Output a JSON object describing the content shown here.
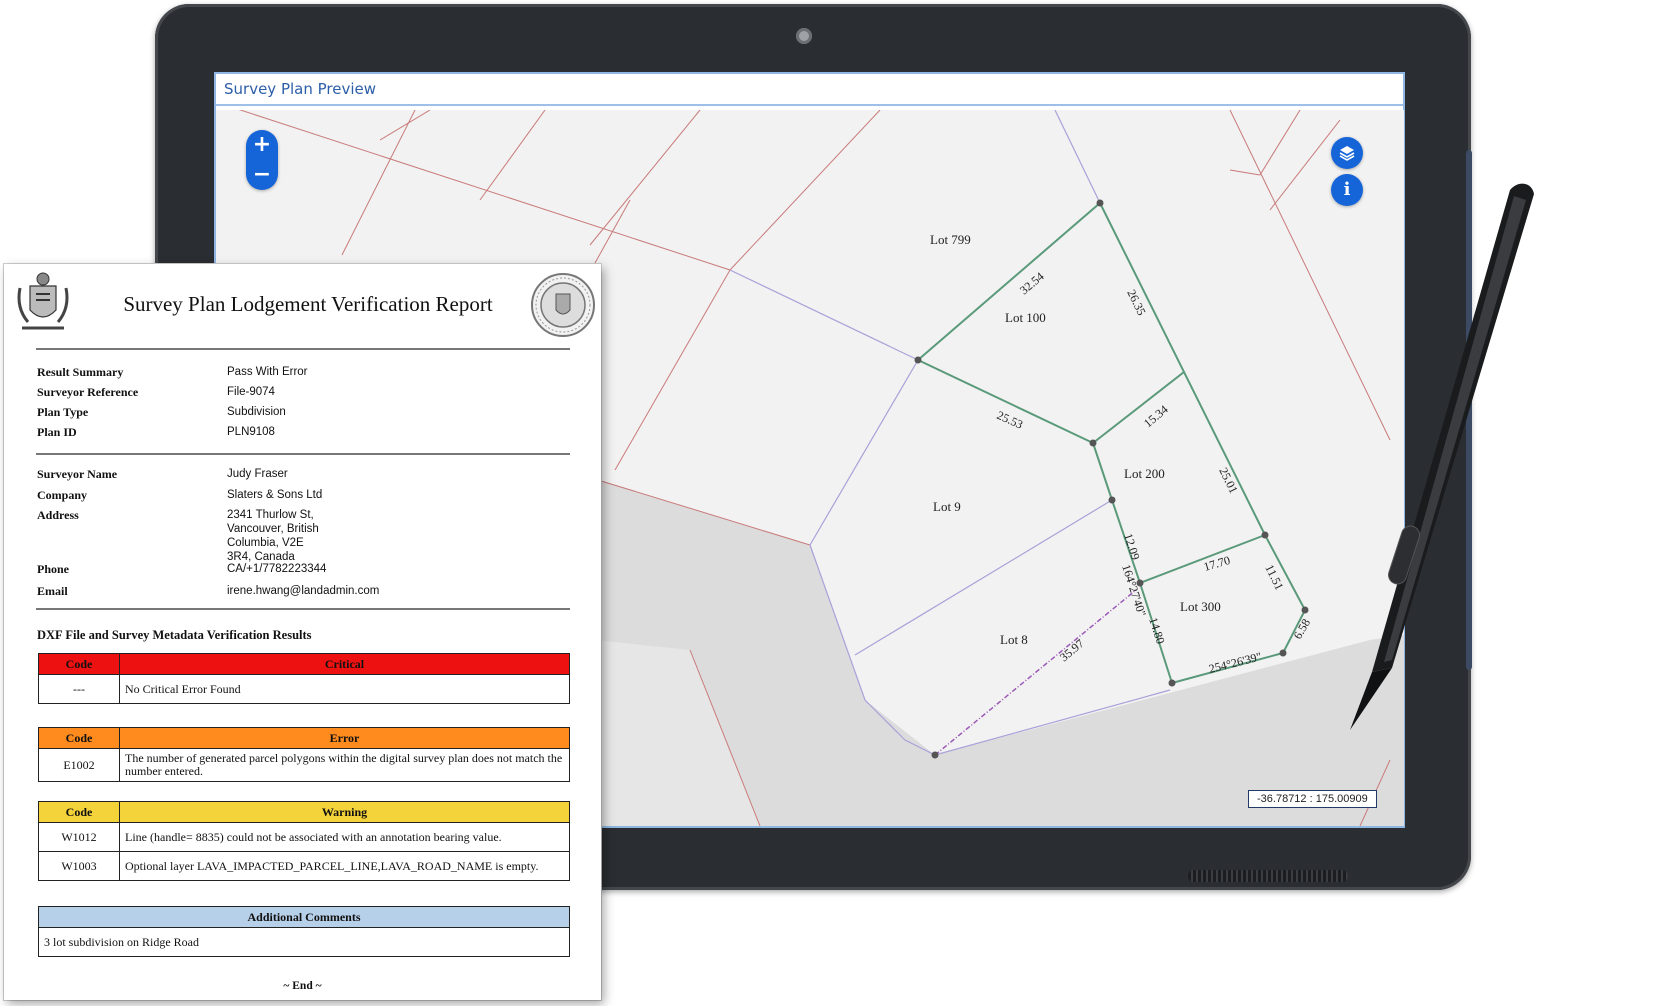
{
  "screen": {
    "title": "Survey Plan Preview"
  },
  "map": {
    "zoom_in_label": "+",
    "zoom_out_label": "−",
    "layers_icon": "layers-icon",
    "info_icon": "info-icon",
    "coordinate_readout": "-36.78712 : 175.00909",
    "lot_labels": [
      "Lot 799",
      "Lot 100",
      "Lot 200",
      "Lot 9",
      "Lot 8",
      "Lot 300"
    ],
    "dimensions": [
      "32.54",
      "26.35",
      "25.53",
      "15.34",
      "25.01",
      "17.70",
      "12.09",
      "11.51",
      "14.80",
      "6.58",
      "35.97",
      "164°27'40\"",
      "254°26'39\""
    ],
    "colors": {
      "parcel_line": "#c56b6b",
      "boundary": "#5a9a7a",
      "road": "#a8a2d9",
      "accent": "#1665d8"
    }
  },
  "report": {
    "title": "Survey Plan Lodgement Verification Report",
    "summary": [
      {
        "label": "Result Summary",
        "value": "Pass With Error"
      },
      {
        "label": "Surveyor Reference",
        "value": "File-9074"
      },
      {
        "label": "Plan Type",
        "value": "Subdivision"
      },
      {
        "label": "Plan ID",
        "value": "PLN9108"
      }
    ],
    "surveyor": [
      {
        "label": "Surveyor Name",
        "value": "Judy Fraser"
      },
      {
        "label": "Company",
        "value": "Slaters & Sons Ltd"
      },
      {
        "label": "Address",
        "value": "2341 Thurlow St,\nVancouver, British\nColumbia, V2E\n3R4, Canada"
      },
      {
        "label": "Phone",
        "value": "CA/+1/7782223344"
      },
      {
        "label": "Email",
        "value": "irene.hwang@landadmin.com"
      }
    ],
    "results_heading": "DXF File and Survey Metadata Verification Results",
    "critical": {
      "code_header": "Code",
      "header": "Critical",
      "color": "#ee1111",
      "rows": [
        {
          "code": "---",
          "text": "No Critical Error Found"
        }
      ]
    },
    "error": {
      "code_header": "Code",
      "header": "Error",
      "color": "#ff8a1e",
      "rows": [
        {
          "code": "E1002",
          "text": "The number of generated parcel polygons within the digital survey plan does not match the number entered."
        }
      ]
    },
    "warning": {
      "code_header": "Code",
      "header": "Warning",
      "color": "#f4d33a",
      "rows": [
        {
          "code": "W1012",
          "text": "Line (handle=  8835) could not be associated with an annotation bearing value."
        },
        {
          "code": "W1003",
          "text": "Optional layer LAVA_IMPACTED_PARCEL_LINE,LAVA_ROAD_NAME is empty."
        }
      ]
    },
    "comments": {
      "header": "Additional Comments",
      "color": "#b7d0ea",
      "text": "3 lot subdivision on Ridge Road"
    },
    "end": "~ End ~"
  }
}
